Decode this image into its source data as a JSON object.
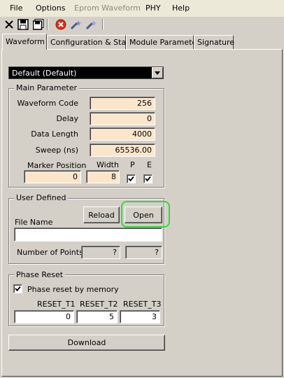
{
  "menu": {
    "file": "File",
    "options": "Options",
    "eprom_waveform": "Eprom Waveform",
    "phy": "PHY",
    "help": "Help"
  },
  "toolbar": {
    "icons": [
      "close-icon",
      "save-icon",
      "save-all-icon",
      "stop-icon",
      "wand-icon",
      "wand-alt-icon"
    ],
    "accent_stop": "#d8341c"
  },
  "tabs": {
    "waveform": "Waveform",
    "config_status": "Configuration & Status",
    "module_parameter": "Module Parameter",
    "signature": "Signature"
  },
  "combo": {
    "selected": "Default (Default)"
  },
  "main_parameter": {
    "title": "Main Parameter",
    "waveform_code_label": "Waveform Code",
    "waveform_code_value": "256",
    "delay_label": "Delay",
    "delay_value": "0",
    "data_length_label": "Data Length",
    "data_length_value": "4000",
    "sweep_label": "Sweep (ns)",
    "sweep_value": "65536.00",
    "marker_position_label": "Marker Position",
    "marker_position_value": "0",
    "width_label": "Width",
    "width_value": "8",
    "p_label": "P",
    "p_checked": true,
    "e_label": "E",
    "e_checked": true
  },
  "user_defined": {
    "title": "User Defined",
    "reload_label": "Reload",
    "open_label": "Open",
    "file_name_label": "File Name",
    "file_name_value": "",
    "number_of_points_label": "Number of Points",
    "points_value_1": "?",
    "points_value_2": "?"
  },
  "phase_reset": {
    "title": "Phase Reset",
    "by_memory_label": "Phase reset by memory",
    "by_memory_checked": true,
    "reset_t1_label": "RESET_T1",
    "reset_t1_value": "0",
    "reset_t2_label": "RESET_T2",
    "reset_t2_value": "5",
    "reset_t3_label": "RESET_T3",
    "reset_t3_value": "3"
  },
  "download_label": "Download",
  "colors": {
    "field_bg": "#fbe6cc",
    "highlight": "#3bd63b",
    "combo_bg": "#000000"
  }
}
